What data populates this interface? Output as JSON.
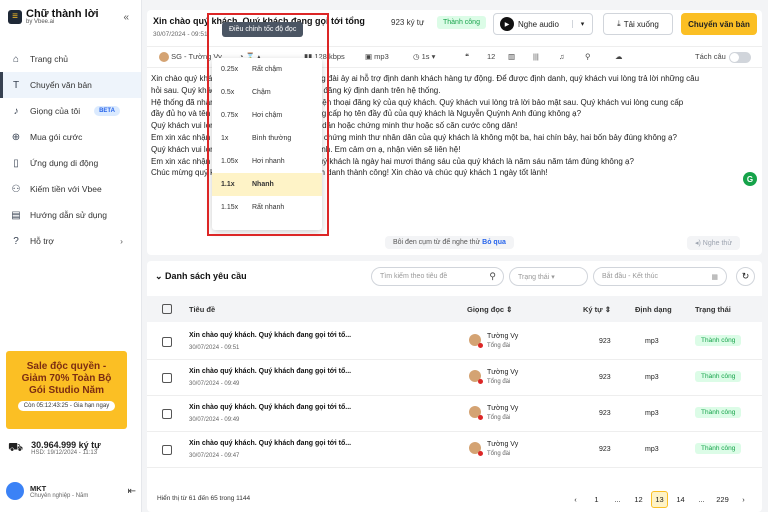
{
  "sidebar": {
    "app_name": "Chữ thành lời",
    "by": "by Vbee.ai",
    "items": [
      {
        "label": "Trang chủ",
        "icon": "home-icon"
      },
      {
        "label": "Chuyển văn bản",
        "icon": "text-icon"
      },
      {
        "label": "Giọng của tôi",
        "icon": "mic-icon",
        "badge": "BETA"
      },
      {
        "label": "Mua gói cước",
        "icon": "cart-icon"
      },
      {
        "label": "Ứng dụng di động",
        "icon": "phone-icon"
      },
      {
        "label": "Kiếm tiền với Vbee",
        "icon": "people-icon"
      },
      {
        "label": "Hướng dẫn sử dụng",
        "icon": "book-icon"
      },
      {
        "label": "Hỗ trợ",
        "icon": "help-icon"
      }
    ],
    "promo": {
      "line1": "Sale độc quyền -",
      "line2": "Giảm 70% Toàn Bộ",
      "line3": "Gói Studio Năm",
      "timer": "Còn 05:12:43:25 - Gia hạn ngay"
    },
    "credits": {
      "value": "30.964.999 ký tự",
      "expiry": "HSD: 19/12/2024 - 11:13"
    },
    "user": {
      "name": "MKT",
      "plan": "Chuyên nghiệp - Năm"
    }
  },
  "editor": {
    "title": "Xin chào quý khách. Quý khách đang gọi tới tổng",
    "date": "30/07/2024 - 09:51",
    "count": "923 ký tự",
    "status": "Thành công",
    "listen_label": "Nghe audio",
    "download_label": "Tải xuống",
    "convert_label": "Chuyển văn bản",
    "toolbar": {
      "voice": "SG - Tường Vy",
      "bitrate": "128 kbps",
      "format": "mp3",
      "pause": "1s",
      "split_label": "Tách câu"
    },
    "body": [
      "Xin chào quý khách. Quý khách đang gọi tới tổng đài ảy ai hỗ trợ định danh khách hàng tự động. Để được định danh, quý khách vui lòng trả lời những câu",
      "hỏi sau. Quý khách đang gọi tới từ số điện thoại đăng ký định danh trên hệ thống.",
      "Hệ thống đã nhận diện số điện thoại này là số điện thoại đăng ký của quý khách. Quý khách vui lòng trả lời bảo mật sau. Quý khách vui lòng cung cấp",
      "đầy đủ họ và tên của quý khách. Quý khách cung cấp họ tên đầy đủ của quý khách là Nguyễn Quỳnh Anh đúng không ạ?",
      "Quý khách vui lòng cung cấp số căn cước công dân hoặc chứng minh thư hoặc số căn cước công dân!",
      "Em xin xác nhận lại số căn cước công dân hoặc chứng minh thư nhân dân của quý khách là không một ba, hai chín bảy, hai bốn bảy đúng không ạ?",
      "Quý khách vui lòng cung cấp ngày tháng năm sinh. Em cảm ơn ạ, nhận viên sẽ liên hệ!",
      "Em xin xác nhận lại ngày tháng năm sinh của quý khách là ngày hai mươi tháng sáu của quý khách là năm sáu năm tám đúng không ạ?",
      "Chúc mừng quý khách đã hoàn tất quá trình định danh thành công! Xin chào và chúc quý khách 1 ngày tốt lành!"
    ],
    "hint_text": "Bôi đen cụm từ để nghe thử",
    "hint_skip": "Bỏ qua",
    "tts_label": "Nghe thử",
    "speed_tooltip": "Điều chỉnh tốc độ đọc",
    "speed_options": [
      {
        "rate": "0.25x",
        "label": "Rất chậm"
      },
      {
        "rate": "0.5x",
        "label": "Chậm"
      },
      {
        "rate": "0.75x",
        "label": "Hơi chậm"
      },
      {
        "rate": "1x",
        "label": "Bình thường"
      },
      {
        "rate": "1.05x",
        "label": "Hơi nhanh"
      },
      {
        "rate": "1.1x",
        "label": "Nhanh"
      },
      {
        "rate": "1.15x",
        "label": "Rất nhanh"
      }
    ],
    "speed_selected": "1.1x"
  },
  "requests": {
    "title": "Danh sách yêu cầu",
    "search_placeholder": "Tìm kiếm theo tiêu đề",
    "status_placeholder": "Trạng thái",
    "date_placeholder": "Bắt đầu - Kết thúc",
    "columns": {
      "title": "Tiêu đề",
      "voice": "Giọng đọc",
      "chars": "Ký tự",
      "format": "Định dạng",
      "status": "Trạng thái"
    },
    "rows": [
      {
        "title": "Xin chào quý khách. Quý khách đang gọi tới tổ...",
        "date": "30/07/2024 - 09:51",
        "voice": "Tường Vy",
        "voice_sub": "Tổng đài",
        "chars": "923",
        "format": "mp3",
        "status": "Thành công"
      },
      {
        "title": "Xin chào quý khách. Quý khách đang gọi tới tổ...",
        "date": "30/07/2024 - 09:49",
        "voice": "Tường Vy",
        "voice_sub": "Tổng đài",
        "chars": "923",
        "format": "mp3",
        "status": "Thành công"
      },
      {
        "title": "Xin chào quý khách. Quý khách đang gọi tới tổ...",
        "date": "30/07/2024 - 09:49",
        "voice": "Tường Vy",
        "voice_sub": "Tổng đài",
        "chars": "923",
        "format": "mp3",
        "status": "Thành công"
      },
      {
        "title": "Xin chào quý khách. Quý khách đang gọi tới tổ...",
        "date": "30/07/2024 - 09:47",
        "voice": "Tường Vy",
        "voice_sub": "Tổng đài",
        "chars": "923",
        "format": "mp3",
        "status": "Thành công"
      }
    ],
    "pager_info": "Hiển thị từ 61 đến 65 trong 1144",
    "pages": [
      "1",
      "...",
      "12",
      "13",
      "14",
      "...",
      "229"
    ],
    "current_page": "13"
  }
}
